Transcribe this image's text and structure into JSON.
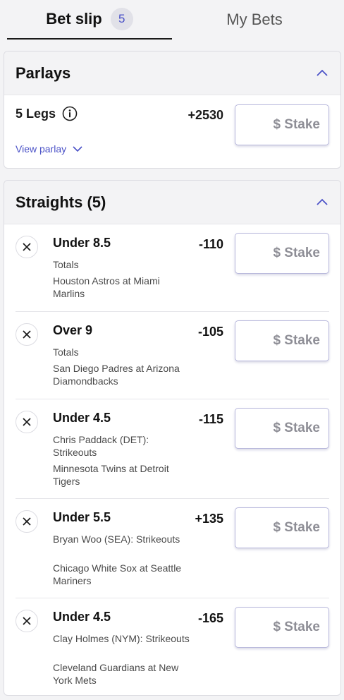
{
  "tabs": {
    "bet_slip": "Bet slip",
    "bet_slip_count": "5",
    "my_bets": "My Bets"
  },
  "parlays": {
    "title": "Parlays",
    "legs": "5 Legs",
    "odds": "+2530",
    "stake_placeholder": "$ Stake",
    "view_parlay": "View parlay"
  },
  "straights": {
    "title": "Straights (5)",
    "bets": [
      {
        "selection": "Under 8.5",
        "odds": "-110",
        "market": "Totals",
        "game": "Houston Astros at Miami Marlins",
        "stake_placeholder": "$ Stake"
      },
      {
        "selection": "Over 9",
        "odds": "-105",
        "market": "Totals",
        "game": "San Diego Padres at Arizona Diamondbacks",
        "stake_placeholder": "$ Stake"
      },
      {
        "selection": "Under 4.5",
        "odds": "-115",
        "market": "Chris Paddack (DET): Strikeouts",
        "game": "Minnesota Twins at Detroit Tigers",
        "stake_placeholder": "$ Stake"
      },
      {
        "selection": "Under 5.5",
        "odds": "+135",
        "market": "Bryan Woo (SEA): Strikeouts",
        "game": "Chicago White Sox at Seattle Mariners",
        "stake_placeholder": "$ Stake"
      },
      {
        "selection": "Under 4.5",
        "odds": "-165",
        "market": "Clay Holmes (NYM): Strikeouts",
        "game": "Cleveland Guardians at New York Mets",
        "stake_placeholder": "$ Stake"
      }
    ]
  },
  "colors": {
    "accent": "#4b52c7",
    "background": "#f3f3f5",
    "card": "#ffffff"
  }
}
